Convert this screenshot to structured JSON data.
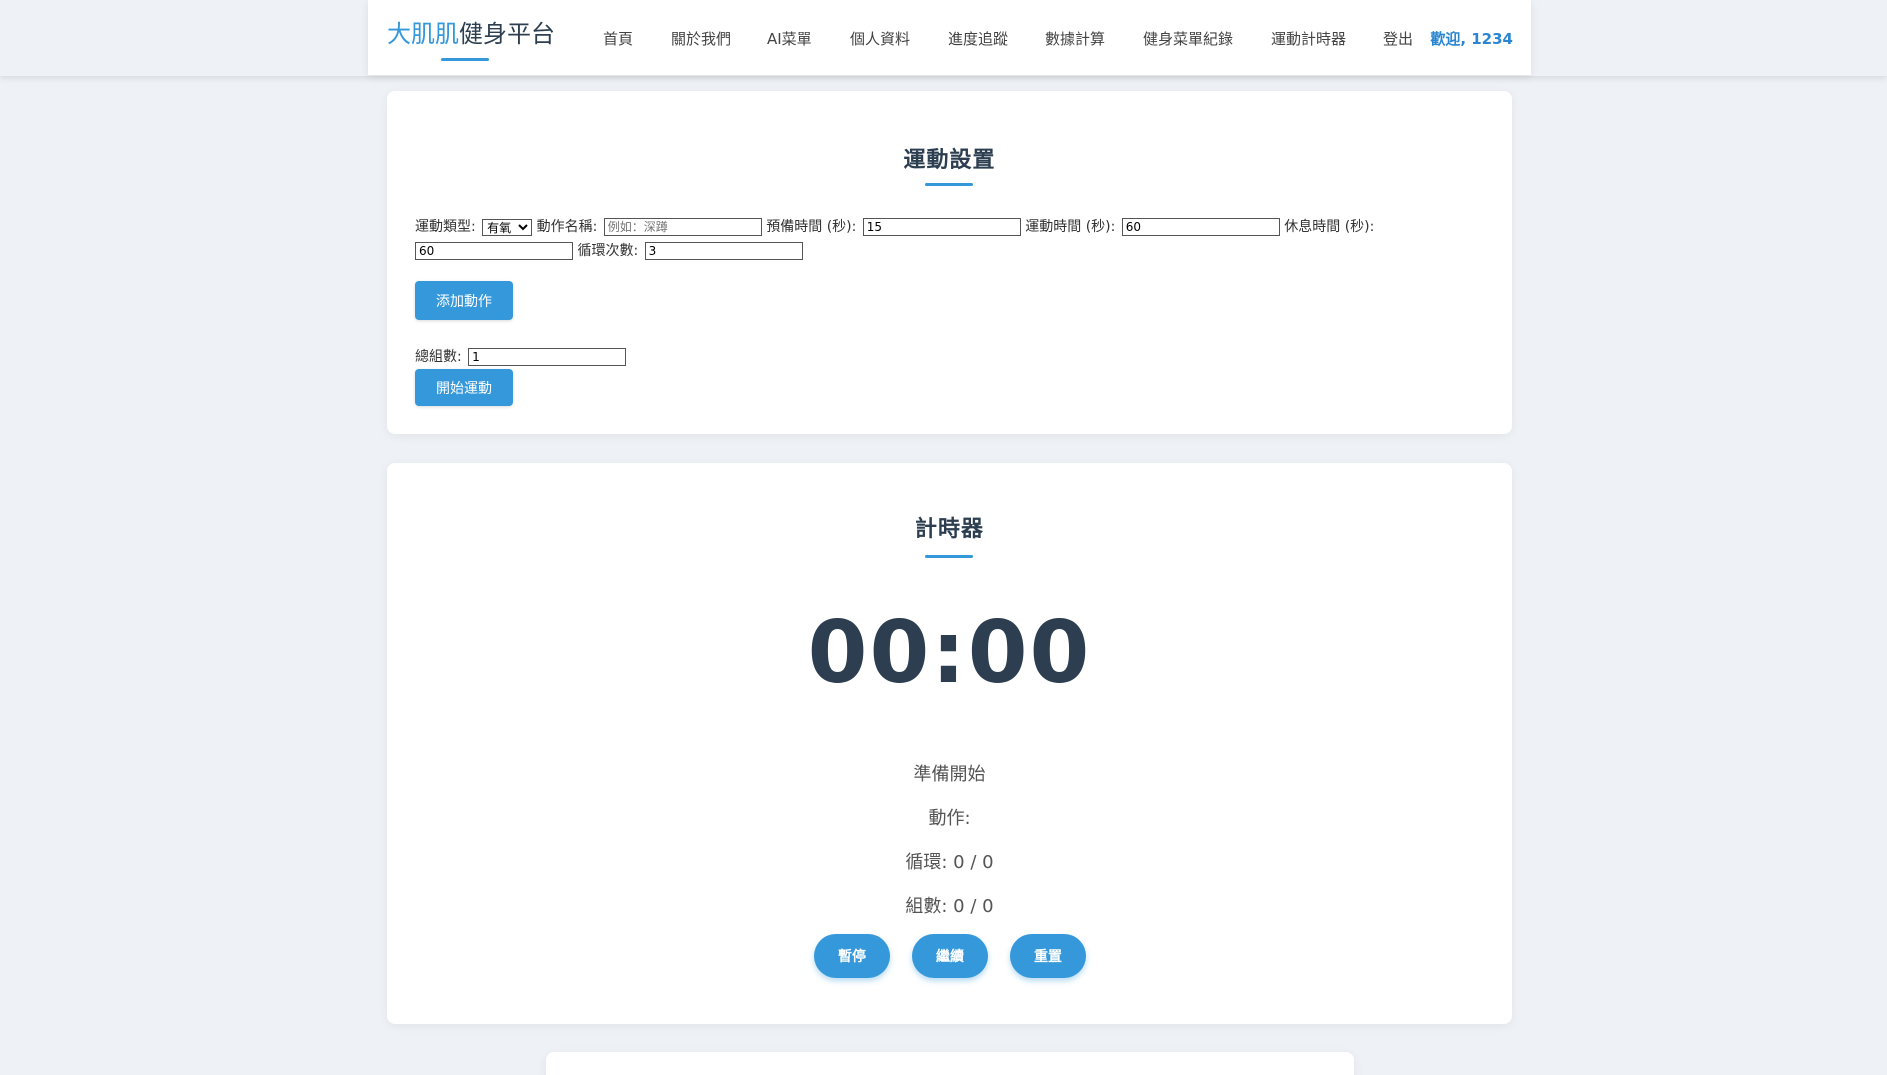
{
  "header": {
    "logo_accent": "大肌肌",
    "logo_rest": "健身平台",
    "nav": [
      "首頁",
      "關於我們",
      "AI菜單",
      "個人資料",
      "進度追蹤",
      "數據計算",
      "健身菜單紀錄",
      "運動計時器",
      "登出"
    ],
    "welcome": "歡迎, 1234"
  },
  "setup": {
    "title": "運動設置",
    "type_label": "運動類型:",
    "type_value": "有氧",
    "name_label": "動作名稱:",
    "name_placeholder": "例如：深蹲",
    "prep_label": "預備時間 (秒):",
    "prep_value": "15",
    "work_label": "運動時間 (秒):",
    "work_value": "60",
    "rest_label": "休息時間 (秒):",
    "rest_value": "60",
    "cycles_label": "循環次數:",
    "cycles_value": "3",
    "add_button": "添加動作",
    "sets_label": "總組數:",
    "sets_value": "1",
    "start_button": "開始運動"
  },
  "timer": {
    "title": "計時器",
    "display": "00:00",
    "status": "準備開始",
    "action_line": "動作:",
    "cycle_line": "循環: 0 / 0",
    "set_line": "組數: 0 / 0",
    "pause_button": "暫停",
    "resume_button": "繼續",
    "reset_button": "重置"
  },
  "colors": {
    "accent": "#3498db",
    "heading": "#2c3e50",
    "background": "#eef1f5"
  }
}
